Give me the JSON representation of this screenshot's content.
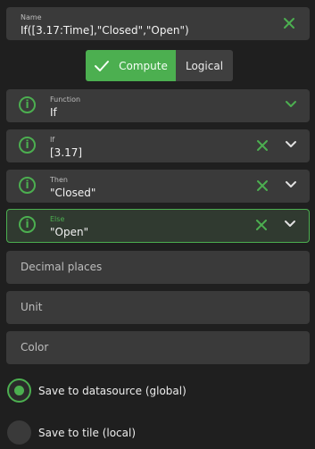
{
  "name_field": {
    "label": "Name",
    "value": "If([3.17:Time],\"Closed\",\"Open\")"
  },
  "mode_toggle": {
    "compute": "Compute",
    "logical": "Logical"
  },
  "function_field": {
    "label": "Function",
    "value": "If"
  },
  "if_field": {
    "label": "If",
    "value": "[3.17]"
  },
  "then_field": {
    "label": "Then",
    "value": "\"Closed\""
  },
  "else_field": {
    "label": "Else",
    "value": "\"Open\""
  },
  "decimal_places": {
    "placeholder": "Decimal places"
  },
  "unit": {
    "placeholder": "Unit"
  },
  "color": {
    "placeholder": "Color"
  },
  "save_options": [
    {
      "label": "Save to datasource (global)",
      "selected": true
    },
    {
      "label": "Save to tile (local)",
      "selected": false
    }
  ],
  "colors": {
    "accent": "#4caf50",
    "surface": "#3a3a3a",
    "background": "#1f1f1f"
  }
}
